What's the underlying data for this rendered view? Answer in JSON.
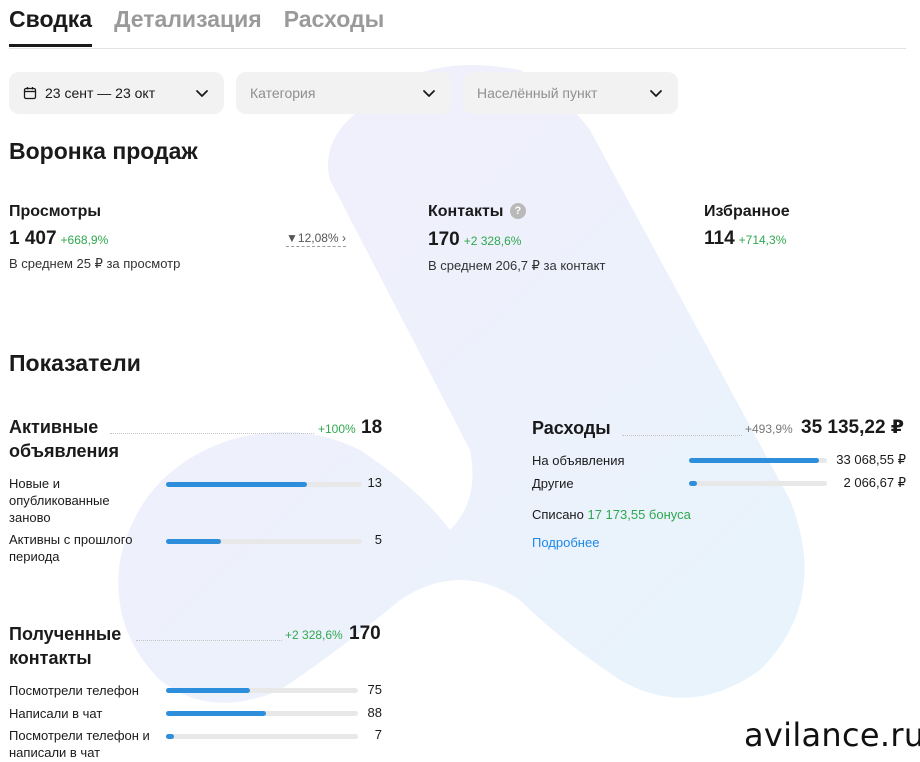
{
  "tabs": [
    {
      "label": "Сводка",
      "active": true
    },
    {
      "label": "Детализация",
      "active": false
    },
    {
      "label": "Расходы",
      "active": false
    }
  ],
  "filters": {
    "date": "23 сент — 23 окт",
    "category_placeholder": "Категория",
    "city_placeholder": "Населённый пункт"
  },
  "funnel": {
    "title": "Воронка продаж",
    "views": {
      "title": "Просмотры",
      "value": "1 407",
      "delta": "+668,9%",
      "sub": "В среднем 25 ₽ за просмотр"
    },
    "conversion": "12,08%",
    "contacts": {
      "title": "Контакты",
      "help": "?",
      "value": "170",
      "delta": "+2 328,6%",
      "sub": "В среднем 206,7 ₽ за контакт"
    },
    "favorites": {
      "title": "Избранное",
      "value": "114",
      "delta": "+714,3%"
    }
  },
  "indicators": {
    "title": "Показатели",
    "active_ads": {
      "title_line1": "Активные",
      "title_line2": "объявления",
      "delta": "+100%",
      "total": "18",
      "rows": [
        {
          "label": "Новые и опубликованные заново",
          "value": "13",
          "fraction": 0.72
        },
        {
          "label": "Активны с прошлого периода",
          "value": "5",
          "fraction": 0.28
        }
      ]
    },
    "expenses": {
      "title": "Расходы",
      "delta": "+493,9%",
      "total": "35 135,22 ₽",
      "rows": [
        {
          "label": "На объявления",
          "value": "33 068,55 ₽",
          "fraction": 0.94
        },
        {
          "label": "Другие",
          "value": "2 066,67 ₽",
          "fraction": 0.06
        }
      ],
      "written_off_label": "Списано",
      "written_off_value": "17 173,55 бонуса",
      "more_link": "Подробнее"
    },
    "contacts": {
      "title_line1": "Полученные",
      "title_line2": "контакты",
      "delta": "+2 328,6%",
      "total": "170",
      "rows": [
        {
          "label": "Посмотрели телефон",
          "value": "75",
          "fraction": 0.44
        },
        {
          "label": "Написали в чат",
          "value": "88",
          "fraction": 0.52
        },
        {
          "label": "Посмотрели телефон и написали в чат",
          "value": "7",
          "fraction": 0.04
        }
      ]
    }
  },
  "watermark": "avilance.ru",
  "colors": {
    "accent": "#2d8fdc",
    "positive": "#2fa84f",
    "link": "#1e88e5"
  }
}
